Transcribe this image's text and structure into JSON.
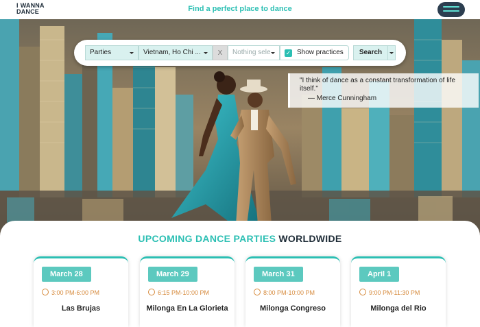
{
  "header": {
    "logo_line1_a": "I",
    "logo_line1_b": "WANNA",
    "logo_line2": "DANCE",
    "tagline": "Find a perfect place to dance"
  },
  "search": {
    "type_value": "Parties",
    "location_value": "Vietnam, Ho Chi ...",
    "clear_label": "X",
    "extra_placeholder": "Nothing sele",
    "show_practices_label": "Show practices",
    "show_practices_checked": true,
    "search_label": "Search"
  },
  "quote": {
    "text": "\"I think of dance as a constant transformation of life itself.\"",
    "author": "— Merce Cunningham"
  },
  "section": {
    "title_highlight": "UPCOMING DANCE PARTIES",
    "title_rest": "WORLDWIDE"
  },
  "events": [
    {
      "date": "March 28",
      "time": "3:00 PM-6:00 PM",
      "name": "Las Brujas"
    },
    {
      "date": "March 29",
      "time": "6:15 PM-10:00 PM",
      "name": "Milonga En La Glorieta"
    },
    {
      "date": "March 31",
      "time": "8:00 PM-10:00 PM",
      "name": "Milonga Congreso"
    },
    {
      "date": "April 1",
      "time": "9:00 PM-11:30 PM",
      "name": "Milonga del Rio"
    }
  ],
  "colors": {
    "accent": "#2bbfb3",
    "date_badge": "#5cc9bf",
    "time_text": "#d68a3c",
    "dark": "#1d2b36"
  }
}
